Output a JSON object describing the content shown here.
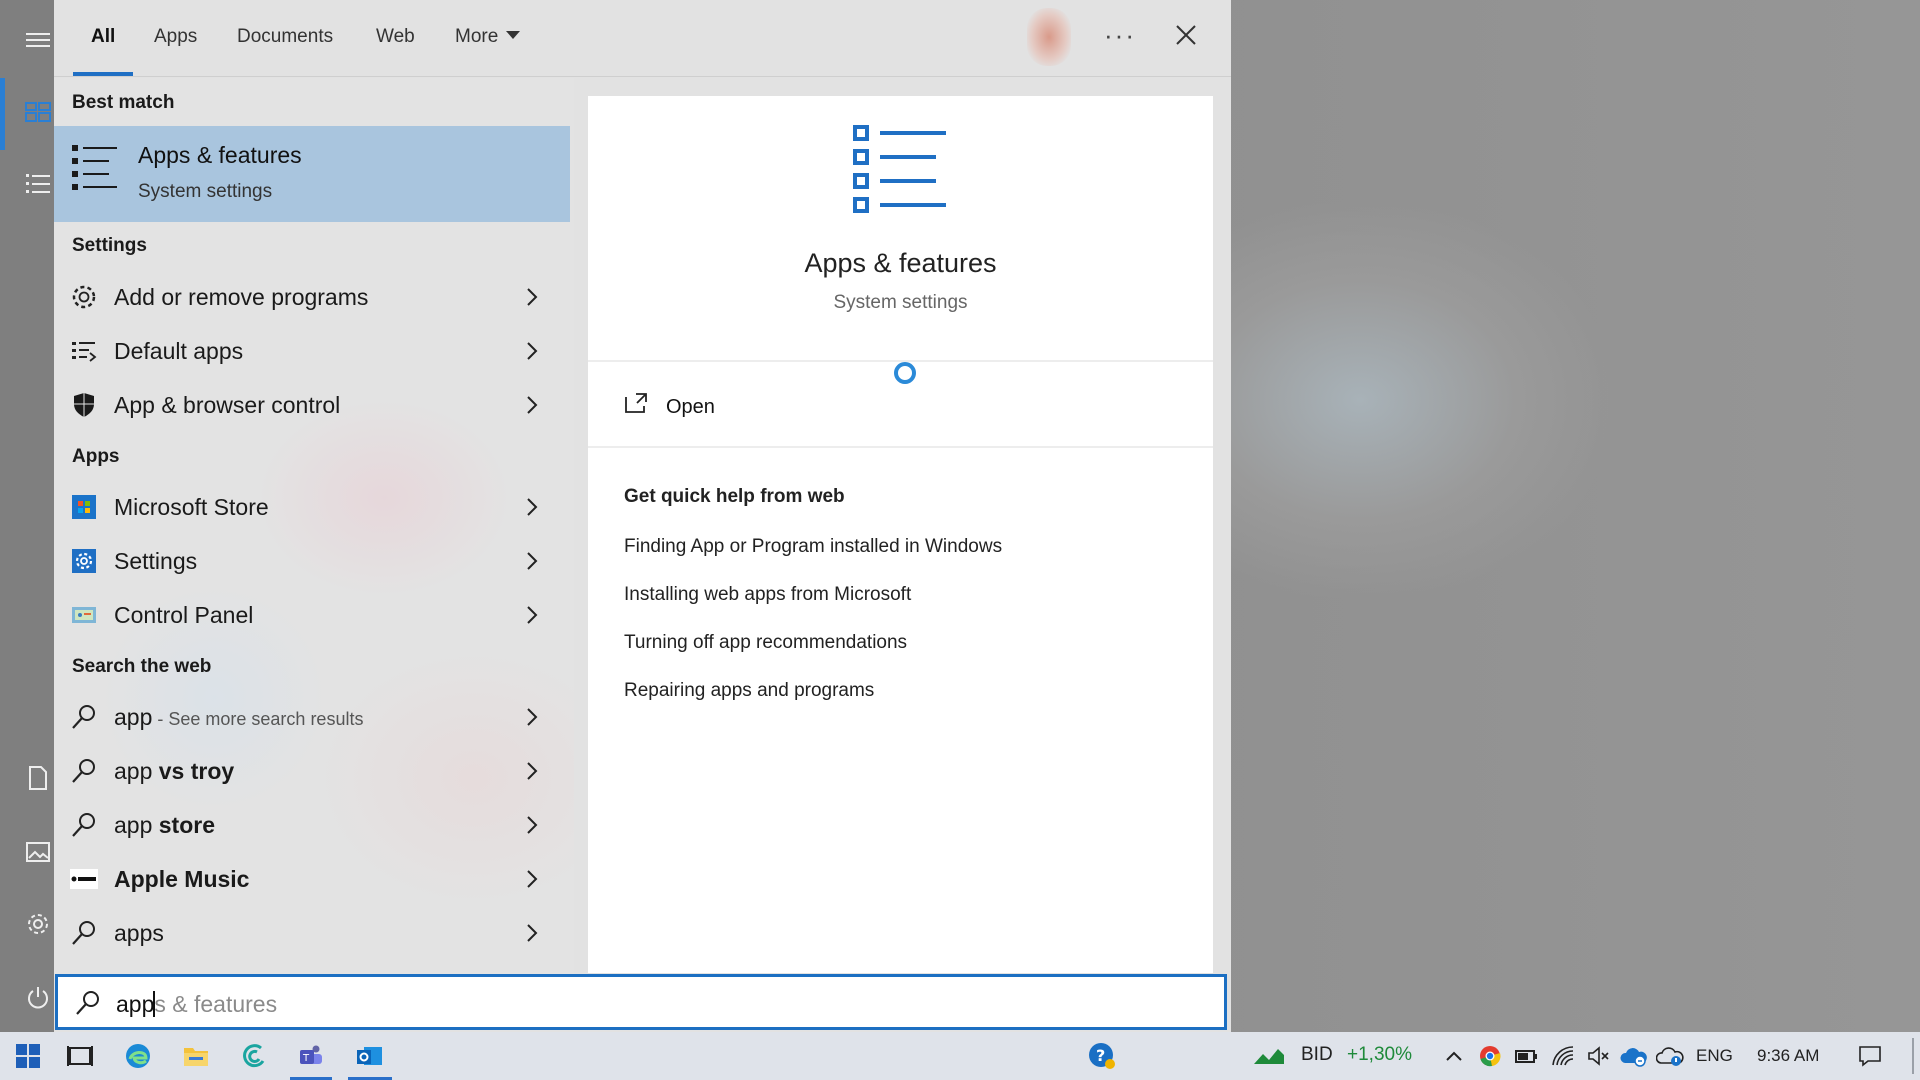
{
  "tabs": [
    {
      "label": "All",
      "active": true
    },
    {
      "label": "Apps",
      "active": false
    },
    {
      "label": "Documents",
      "active": false
    },
    {
      "label": "Web",
      "active": false
    },
    {
      "label": "More",
      "active": false
    }
  ],
  "best_match": {
    "section": "Best match",
    "title": "Apps & features",
    "subtitle": "System settings"
  },
  "settings": {
    "section": "Settings",
    "items": [
      {
        "label": "Add or remove programs",
        "icon": "gear-icon"
      },
      {
        "label": "Default apps",
        "icon": "default-apps-icon"
      },
      {
        "label": "App & browser control",
        "icon": "shield-icon"
      }
    ]
  },
  "apps": {
    "section": "Apps",
    "items": [
      {
        "label": "Microsoft Store",
        "icon": "microsoft-store-icon"
      },
      {
        "label": "Settings",
        "icon": "settings-app-icon"
      },
      {
        "label": "Control Panel",
        "icon": "control-panel-icon"
      }
    ]
  },
  "web": {
    "section": "Search the web",
    "items": [
      {
        "label": "app",
        "suffix": " - See more search results",
        "icon": "search-icon"
      },
      {
        "label": "app",
        "suffix_bold": " vs troy",
        "icon": "search-icon"
      },
      {
        "label": "app",
        "suffix_bold": " store",
        "icon": "search-icon"
      },
      {
        "label": "Apple Music",
        "icon": "apple-music-icon"
      },
      {
        "label": "apps",
        "icon": "search-icon"
      }
    ]
  },
  "preview": {
    "title": "Apps & features",
    "subtitle": "System settings",
    "open_label": "Open",
    "help_heading": "Get quick help from web",
    "help_links": [
      "Finding App or Program installed in Windows",
      "Installing web apps from Microsoft",
      "Turning off app recommendations",
      "Repairing apps and programs"
    ]
  },
  "search": {
    "typed": "app",
    "hint": "s & features"
  },
  "taskbar": {
    "stock_ticker": "BID",
    "stock_change": "+1,30%",
    "language": "ENG",
    "time": "9:36 AM"
  },
  "colors": {
    "accent": "#1f6fc4",
    "selection": "#a9c5de",
    "stock_up": "#1e8a3a"
  }
}
